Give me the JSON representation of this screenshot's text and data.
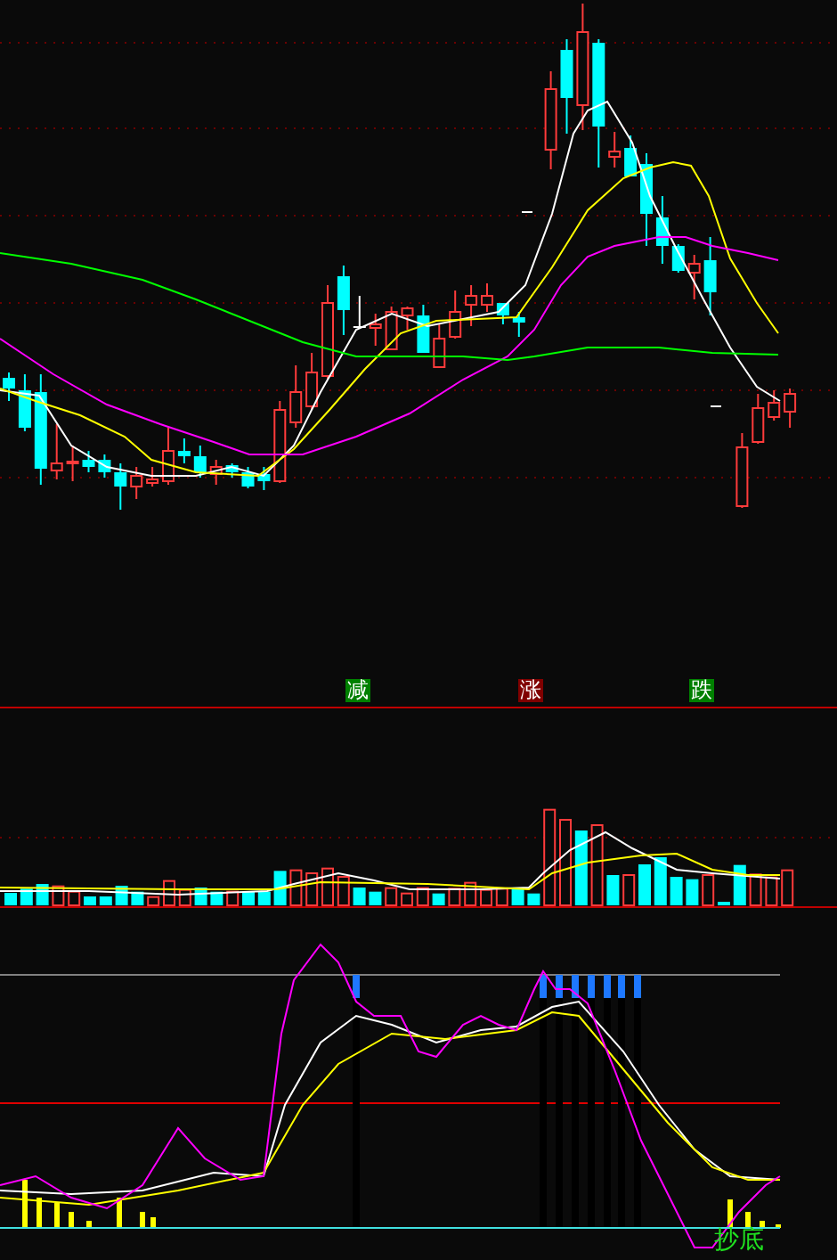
{
  "main_chart": {
    "signals": [
      {
        "label": "减",
        "color": "#008000"
      },
      {
        "label": "涨",
        "color": "#800000"
      },
      {
        "label": "跌",
        "color": "#008000"
      }
    ]
  },
  "indicator_panel": {
    "signal_label": "抄底"
  }
}
